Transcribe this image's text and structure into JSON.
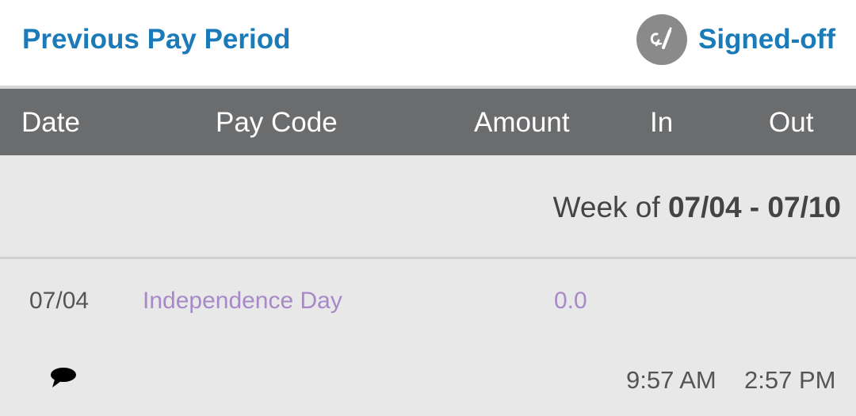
{
  "topbar": {
    "previous_label": "Previous Pay Period",
    "signed_label": "Signed-off",
    "signed_icon": "signature-icon"
  },
  "header": {
    "date": "Date",
    "pay_code": "Pay Code",
    "amount": "Amount",
    "in": "In",
    "out": "Out"
  },
  "week": {
    "prefix": "Week of ",
    "range": "07/04 - 07/10"
  },
  "entries": [
    {
      "date": "07/04",
      "pay_code": "Independence Day",
      "amount": "0.0",
      "in": "9:57 AM",
      "out": "2:57 PM",
      "comment_icon": "comment-bubble-icon"
    }
  ],
  "colors": {
    "link_blue": "#1a7bb8",
    "header_gray": "#6b6c6e",
    "content_bg": "#e8e8e8",
    "paycode_purple": "#a889c7"
  }
}
